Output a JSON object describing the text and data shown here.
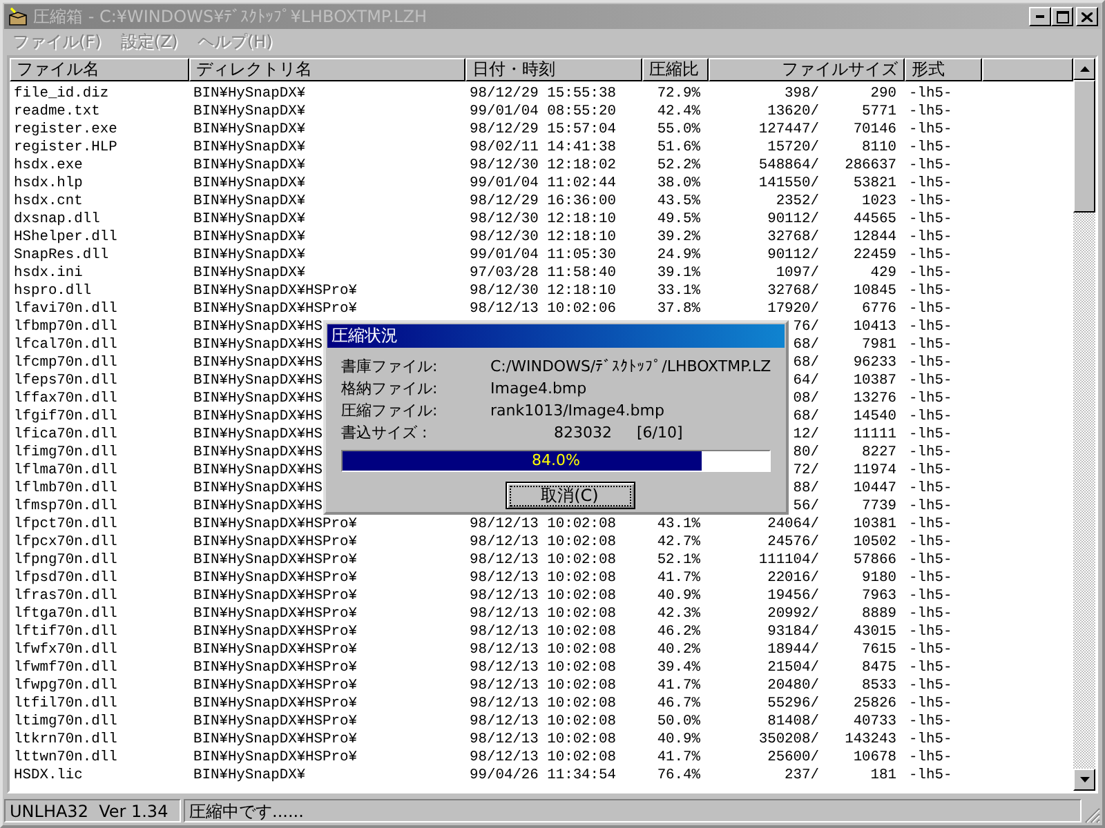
{
  "window": {
    "title": "圧縮箱 - C:¥WINDOWS¥ﾃﾞｽｸﾄｯﾌﾟ¥LHBOXTMP.LZH",
    "active": false
  },
  "menu": [
    {
      "label": "ファイル(F)",
      "disabled": true
    },
    {
      "label": "設定(Z)",
      "disabled": true
    },
    {
      "label": "ヘルプ(H)",
      "disabled": true
    }
  ],
  "table": {
    "columns": [
      {
        "label": "ファイル名"
      },
      {
        "label": "ディレクトリ名"
      },
      {
        "label": "日付・時刻"
      },
      {
        "label": "圧縮比"
      },
      {
        "label": "ファイルサイズ"
      },
      {
        "label": "形式"
      }
    ],
    "rows": [
      {
        "name": "file_id.diz",
        "directory": "BIN¥HySnapDX¥",
        "date": "98/12/29 15:55:38",
        "ratio": "72.9%",
        "size": "398/",
        "packed": "290",
        "format": "-lh5-"
      },
      {
        "name": "readme.txt",
        "directory": "BIN¥HySnapDX¥",
        "date": "99/01/04 08:55:20",
        "ratio": "42.4%",
        "size": "13620/",
        "packed": "5771",
        "format": "-lh5-"
      },
      {
        "name": "register.exe",
        "directory": "BIN¥HySnapDX¥",
        "date": "98/12/29 15:57:04",
        "ratio": "55.0%",
        "size": "127447/",
        "packed": "70146",
        "format": "-lh5-"
      },
      {
        "name": "register.HLP",
        "directory": "BIN¥HySnapDX¥",
        "date": "98/02/11 14:41:38",
        "ratio": "51.6%",
        "size": "15720/",
        "packed": "8110",
        "format": "-lh5-"
      },
      {
        "name": "hsdx.exe",
        "directory": "BIN¥HySnapDX¥",
        "date": "98/12/30 12:18:02",
        "ratio": "52.2%",
        "size": "548864/",
        "packed": "286637",
        "format": "-lh5-"
      },
      {
        "name": "hsdx.hlp",
        "directory": "BIN¥HySnapDX¥",
        "date": "99/01/04 11:02:44",
        "ratio": "38.0%",
        "size": "141550/",
        "packed": "53821",
        "format": "-lh5-"
      },
      {
        "name": "hsdx.cnt",
        "directory": "BIN¥HySnapDX¥",
        "date": "98/12/29 16:36:00",
        "ratio": "43.5%",
        "size": "2352/",
        "packed": "1023",
        "format": "-lh5-"
      },
      {
        "name": "dxsnap.dll",
        "directory": "BIN¥HySnapDX¥",
        "date": "98/12/30 12:18:10",
        "ratio": "49.5%",
        "size": "90112/",
        "packed": "44565",
        "format": "-lh5-"
      },
      {
        "name": "HShelper.dll",
        "directory": "BIN¥HySnapDX¥",
        "date": "98/12/30 12:18:10",
        "ratio": "39.2%",
        "size": "32768/",
        "packed": "12844",
        "format": "-lh5-"
      },
      {
        "name": "SnapRes.dll",
        "directory": "BIN¥HySnapDX¥",
        "date": "99/01/04 11:05:30",
        "ratio": "24.9%",
        "size": "90112/",
        "packed": "22459",
        "format": "-lh5-"
      },
      {
        "name": "hsdx.ini",
        "directory": "BIN¥HySnapDX¥",
        "date": "97/03/28 11:58:40",
        "ratio": "39.1%",
        "size": "1097/",
        "packed": "429",
        "format": "-lh5-"
      },
      {
        "name": "hspro.dll",
        "directory": "BIN¥HySnapDX¥HSPro¥",
        "date": "98/12/30 12:18:10",
        "ratio": "33.1%",
        "size": "32768/",
        "packed": "10845",
        "format": "-lh5-"
      },
      {
        "name": "lfavi70n.dll",
        "directory": "BIN¥HySnapDX¥HSPro¥",
        "date": "98/12/13 10:02:06",
        "ratio": "37.8%",
        "size": "17920/",
        "packed": "6776",
        "format": "-lh5-"
      },
      {
        "name": "lfbmp70n.dll",
        "directory": "BIN¥HySnapDX¥HS",
        "size": "76/",
        "packed": "10413",
        "format": "-lh5-"
      },
      {
        "name": "lfcal70n.dll",
        "directory": "BIN¥HySnapDX¥HS",
        "size": "68/",
        "packed": "7981",
        "format": "-lh5-"
      },
      {
        "name": "lfcmp70n.dll",
        "directory": "BIN¥HySnapDX¥HS",
        "size": "68/",
        "packed": "96233",
        "format": "-lh5-"
      },
      {
        "name": "lfeps70n.dll",
        "directory": "BIN¥HySnapDX¥HS",
        "size": "64/",
        "packed": "10387",
        "format": "-lh5-"
      },
      {
        "name": "lffax70n.dll",
        "directory": "BIN¥HySnapDX¥HS",
        "size": "08/",
        "packed": "13276",
        "format": "-lh5-"
      },
      {
        "name": "lfgif70n.dll",
        "directory": "BIN¥HySnapDX¥HS",
        "size": "68/",
        "packed": "14540",
        "format": "-lh5-"
      },
      {
        "name": "lfica70n.dll",
        "directory": "BIN¥HySnapDX¥HS",
        "size": "12/",
        "packed": "11111",
        "format": "-lh5-"
      },
      {
        "name": "lfimg70n.dll",
        "directory": "BIN¥HySnapDX¥HS",
        "size": "80/",
        "packed": "8227",
        "format": "-lh5-"
      },
      {
        "name": "lflma70n.dll",
        "directory": "BIN¥HySnapDX¥HS",
        "size": "72/",
        "packed": "11974",
        "format": "-lh5-"
      },
      {
        "name": "lflmb70n.dll",
        "directory": "BIN¥HySnapDX¥HS",
        "size": "88/",
        "packed": "10447",
        "format": "-lh5-"
      },
      {
        "name": "lfmsp70n.dll",
        "directory": "BIN¥HySnapDX¥HS",
        "size": "56/",
        "packed": "7739",
        "format": "-lh5-"
      },
      {
        "name": "lfpct70n.dll",
        "directory": "BIN¥HySnapDX¥HSPro¥",
        "date": "98/12/13 10:02:08",
        "ratio": "43.1%",
        "size": "24064/",
        "packed": "10381",
        "format": "-lh5-"
      },
      {
        "name": "lfpcx70n.dll",
        "directory": "BIN¥HySnapDX¥HSPro¥",
        "date": "98/12/13 10:02:08",
        "ratio": "42.7%",
        "size": "24576/",
        "packed": "10502",
        "format": "-lh5-"
      },
      {
        "name": "lfpng70n.dll",
        "directory": "BIN¥HySnapDX¥HSPro¥",
        "date": "98/12/13 10:02:08",
        "ratio": "52.1%",
        "size": "111104/",
        "packed": "57866",
        "format": "-lh5-"
      },
      {
        "name": "lfpsd70n.dll",
        "directory": "BIN¥HySnapDX¥HSPro¥",
        "date": "98/12/13 10:02:08",
        "ratio": "41.7%",
        "size": "22016/",
        "packed": "9180",
        "format": "-lh5-"
      },
      {
        "name": "lfras70n.dll",
        "directory": "BIN¥HySnapDX¥HSPro¥",
        "date": "98/12/13 10:02:08",
        "ratio": "40.9%",
        "size": "19456/",
        "packed": "7963",
        "format": "-lh5-"
      },
      {
        "name": "lftga70n.dll",
        "directory": "BIN¥HySnapDX¥HSPro¥",
        "date": "98/12/13 10:02:08",
        "ratio": "42.3%",
        "size": "20992/",
        "packed": "8889",
        "format": "-lh5-"
      },
      {
        "name": "lftif70n.dll",
        "directory": "BIN¥HySnapDX¥HSPro¥",
        "date": "98/12/13 10:02:08",
        "ratio": "46.2%",
        "size": "93184/",
        "packed": "43015",
        "format": "-lh5-"
      },
      {
        "name": "lfwfx70n.dll",
        "directory": "BIN¥HySnapDX¥HSPro¥",
        "date": "98/12/13 10:02:08",
        "ratio": "40.2%",
        "size": "18944/",
        "packed": "7615",
        "format": "-lh5-"
      },
      {
        "name": "lfwmf70n.dll",
        "directory": "BIN¥HySnapDX¥HSPro¥",
        "date": "98/12/13 10:02:08",
        "ratio": "39.4%",
        "size": "21504/",
        "packed": "8475",
        "format": "-lh5-"
      },
      {
        "name": "lfwpg70n.dll",
        "directory": "BIN¥HySnapDX¥HSPro¥",
        "date": "98/12/13 10:02:08",
        "ratio": "41.7%",
        "size": "20480/",
        "packed": "8533",
        "format": "-lh5-"
      },
      {
        "name": "ltfil70n.dll",
        "directory": "BIN¥HySnapDX¥HSPro¥",
        "date": "98/12/13 10:02:08",
        "ratio": "46.7%",
        "size": "55296/",
        "packed": "25826",
        "format": "-lh5-"
      },
      {
        "name": "ltimg70n.dll",
        "directory": "BIN¥HySnapDX¥HSPro¥",
        "date": "98/12/13 10:02:08",
        "ratio": "50.0%",
        "size": "81408/",
        "packed": "40733",
        "format": "-lh5-"
      },
      {
        "name": "ltkrn70n.dll",
        "directory": "BIN¥HySnapDX¥HSPro¥",
        "date": "98/12/13 10:02:08",
        "ratio": "40.9%",
        "size": "350208/",
        "packed": "143243",
        "format": "-lh5-"
      },
      {
        "name": "lttwn70n.dll",
        "directory": "BIN¥HySnapDX¥HSPro¥",
        "date": "98/12/13 10:02:08",
        "ratio": "41.7%",
        "size": "25600/",
        "packed": "10678",
        "format": "-lh5-"
      },
      {
        "name": "HSDX.lic",
        "directory": "BIN¥HySnapDX¥",
        "date": "99/04/26 11:34:54",
        "ratio": "76.4%",
        "size": "237/",
        "packed": "181",
        "format": "-lh5-"
      }
    ]
  },
  "dialog": {
    "title": "圧縮状況",
    "active": true,
    "fields": [
      {
        "label": "書庫ファイル:",
        "value": "C:/WINDOWS/ﾃﾞｽｸﾄｯﾌﾟ/LHBOXTMP.LZ"
      },
      {
        "label": "格納ファイル:",
        "value": "Image4.bmp"
      },
      {
        "label": "圧縮ファイル:",
        "value": "rank1013/Image4.bmp"
      }
    ],
    "size_label": "書込サイズ :",
    "size_value": "823032",
    "size_count": "[6/10]",
    "progress": {
      "level": 0.84,
      "text": "84.0%"
    },
    "button": "取消(C)"
  },
  "status_bar": [
    "UNLHA32  Ver 1.34",
    "圧縮中です......"
  ]
}
